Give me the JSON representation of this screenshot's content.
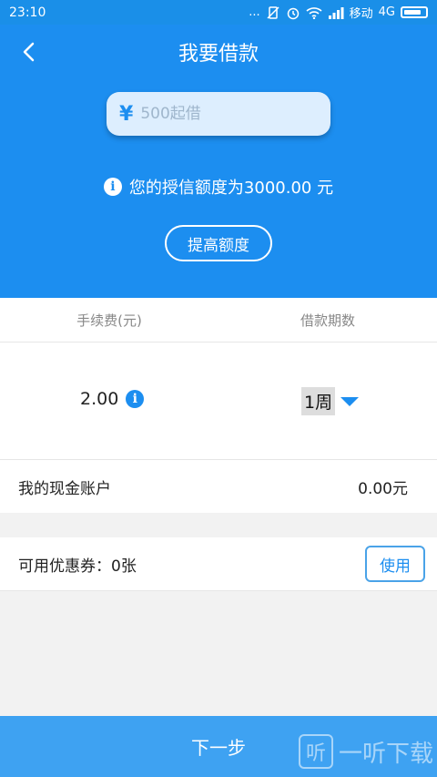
{
  "status_bar": {
    "time": "23:10",
    "dots": "...",
    "carrier": "移动",
    "network": "4G"
  },
  "header": {
    "title": "我要借款",
    "back_icon": "chevron-left-icon"
  },
  "loan_input": {
    "currency_symbol": "¥",
    "placeholder": "500起借",
    "value": ""
  },
  "credit": {
    "text": "您的授信额度为3000.00 元",
    "info_icon": "i"
  },
  "raise_button": {
    "label": "提高额度"
  },
  "table": {
    "headers": [
      "手续费(元)",
      "借款期数"
    ],
    "fee": "2.00",
    "fee_info_icon": "i",
    "period": "1周"
  },
  "cash_account": {
    "label": "我的现金账户",
    "value": "0.00元"
  },
  "coupon": {
    "label": "可用优惠券：0张",
    "button": "使用"
  },
  "next_button": {
    "label": "下一步"
  },
  "watermark": {
    "icon": "听",
    "text": "一听下载"
  },
  "colors": {
    "primary": "#1c8ef0",
    "button": "#3ea2f2",
    "background": "#f2f2f2"
  }
}
